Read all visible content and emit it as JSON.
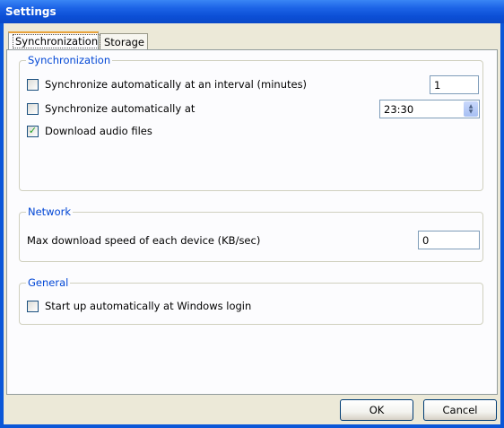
{
  "window": {
    "title": "Settings"
  },
  "tabs": [
    {
      "label": "Synchronization",
      "active": true
    },
    {
      "label": "Storage",
      "active": false
    }
  ],
  "sync_group": {
    "legend": "Synchronization",
    "interval_label": "Synchronize automatically at an interval (minutes)",
    "interval_checked": false,
    "interval_value": "1",
    "at_time_label": "Synchronize automatically at",
    "at_time_checked": false,
    "at_time_value": "23:30",
    "download_audio_label": "Download audio files",
    "download_audio_checked": true
  },
  "network_group": {
    "legend": "Network",
    "max_speed_label": "Max download speed of each device (KB/sec)",
    "max_speed_value": "0"
  },
  "general_group": {
    "legend": "General",
    "startup_label": "Start up automatically at Windows login",
    "startup_checked": false
  },
  "buttons": {
    "ok": "OK",
    "cancel": "Cancel"
  },
  "colors": {
    "titlebar": "#0a49c8",
    "legend_text": "#0046d5",
    "checkmark": "#21a121"
  },
  "icons": {
    "checkmark": "check-icon",
    "spinner": "spin-arrows-icon"
  }
}
